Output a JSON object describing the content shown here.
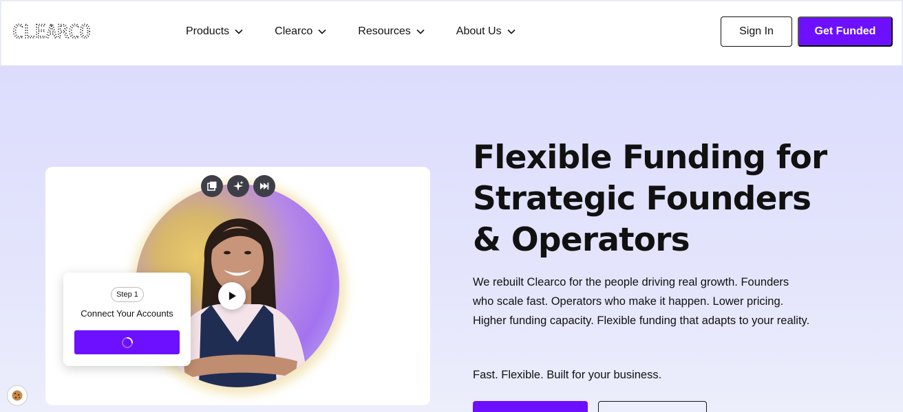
{
  "header": {
    "logo_text": "CLEARCO",
    "nav": [
      {
        "label": "Products"
      },
      {
        "label": "Clearco"
      },
      {
        "label": "Resources"
      },
      {
        "label": "About Us"
      }
    ],
    "sign_in_label": "Sign In",
    "get_funded_label": "Get Funded"
  },
  "media": {
    "controls": [
      "picture-in-picture-icon",
      "sparkle-icon",
      "skip-forward-icon"
    ],
    "play_icon": "play-icon",
    "step_card": {
      "step_label": "Step 1",
      "title": "Connect Your Accounts",
      "button_icon": "spinner-icon"
    }
  },
  "hero": {
    "headline_lines": [
      "Flexible Funding for",
      "Strategic Founders",
      "& Operators"
    ],
    "body": "We rebuilt Clearco for the people driving real growth. Founders who scale fast. Operators who make it happen. Lower pricing. Higher funding capacity. Flexible funding that adapts to your reality.",
    "tagline": "Fast. Flexible. Built for your business."
  },
  "cookie_icon": "cookie-icon",
  "colors": {
    "accent": "#6c10ff",
    "hero_bg": "#dfe0fd",
    "text": "#111111"
  }
}
